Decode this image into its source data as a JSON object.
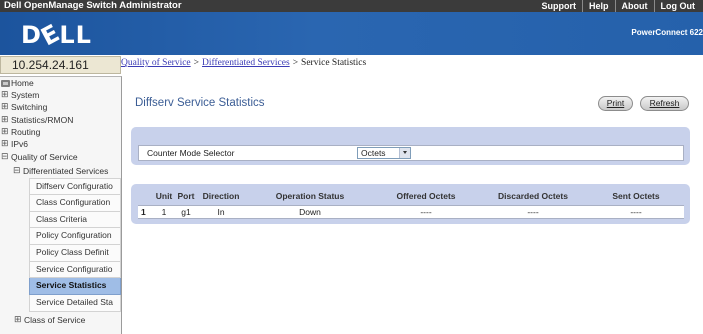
{
  "app": {
    "title": "Dell OpenManage Switch Administrator",
    "top_links": {
      "support": "Support",
      "help": "Help",
      "about": "About",
      "logout": "Log Out"
    },
    "brand_logo": "DELL",
    "product_name": "PowerConnect 622",
    "ip_address": "10.254.24.161"
  },
  "breadcrumb": {
    "items": [
      "Quality of Service",
      "Differentiated Services",
      "Service Statistics"
    ],
    "separator": ">"
  },
  "nav": {
    "home": "Home",
    "sections": [
      {
        "label": "System",
        "expanded": false
      },
      {
        "label": "Switching",
        "expanded": false
      },
      {
        "label": "Statistics/RMON",
        "expanded": false
      },
      {
        "label": "Routing",
        "expanded": false
      },
      {
        "label": "IPv6",
        "expanded": false
      },
      {
        "label": "Quality of Service",
        "expanded": true,
        "children": [
          {
            "label": "Differentiated Services",
            "expanded": true,
            "children": [
              {
                "label": "Diffserv Configuratio",
                "selected": false
              },
              {
                "label": "Class Configuration",
                "selected": false
              },
              {
                "label": "Class Criteria",
                "selected": false
              },
              {
                "label": "Policy Configuration",
                "selected": false
              },
              {
                "label": "Policy Class Definit",
                "selected": false
              },
              {
                "label": "Service Configuratio",
                "selected": false
              },
              {
                "label": "Service Statistics",
                "selected": true
              },
              {
                "label": "Service Detailed Sta",
                "selected": false
              }
            ]
          },
          {
            "label": "Class of Service",
            "expanded": false
          }
        ]
      }
    ]
  },
  "page": {
    "title": "Diffserv Service Statistics",
    "buttons": {
      "print": "Print",
      "refresh": "Refresh"
    },
    "counter_mode": {
      "label": "Counter Mode Selector",
      "value": "Octets"
    },
    "stats_table": {
      "columns": [
        "Unit",
        "Port",
        "Direction",
        "Operation Status",
        "Offered Octets",
        "Discarded Octets",
        "Sent Octets"
      ],
      "rows": [
        [
          "1",
          "1",
          "g1",
          "In",
          "Down",
          "----",
          "----",
          "----"
        ]
      ]
    }
  },
  "icons": {
    "home": "home-icon",
    "collapsed_node": "expand-icon",
    "expanded_node": "collapse-icon",
    "dropdown": "chevron-down-icon"
  },
  "colors": {
    "top_bar": "#3b3b3b",
    "banner": "#2a66b1",
    "panel": "#c8d1eb",
    "selected_nav": "#9fbde6",
    "page_title": "#3b5d95",
    "link": "#3b3bb5"
  }
}
